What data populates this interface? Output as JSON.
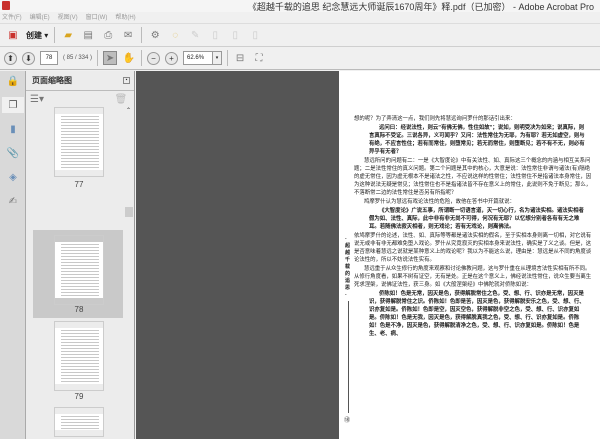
{
  "window": {
    "title": "《超越千载的追思 纪念慧远大师诞辰1670周年》释.pdf（已加密） - Adobe Acrobat Pro"
  },
  "menu": [
    "文件(F)",
    "编辑(E)",
    "视图(V)",
    "窗口(W)",
    "帮助(H)"
  ],
  "toolbar": {
    "create_label": "创建 ▾"
  },
  "nav": {
    "page_value": "78",
    "page_count": "( 85 / 334 )",
    "zoom_value": "62.6%"
  },
  "panel": {
    "title": "页面缩略图",
    "thumbnails": [
      "77",
      "78",
      "79"
    ]
  },
  "page": {
    "side_title": "·超越千载的追思·",
    "page_number": "⑱",
    "paragraphs": [
      "想的呢？为了弄清这一点，我们则先将慧远询问罗什的那话引出来：",
      "远问曰：经说法性，则云\"有佛无佛，性住如故\"；说如，则明受决为如来；说真际，则言真际不受证。三说各异，义可闻乎？又问：法性常住为无耶，为有耶？若无如虚空，则与有绝，不应言性住；若有而常住，则堕常见；若无而常住，则堕断见；若不有不无，则必有异乎有无者？",
      "慧远所问的问题有二：一是《大智度论》中有关法性、如、真际这三个概念的内涵与相互关系问题；二是法性常住的真义问题。第二个问题是其中的核心，大意是说：法性常住非谓与诸法(有)隔绝的虚无常住，因为虚无根本不是诸法之性，不应说这样的性常住；法性常住不是指诸法本身常住，因为这种说法无疑是常见；法性常住也不是指诸法皆不存在意义上的常住，此说则不免于断见；那么，不落断常二边的法性常住是否另有所指呢？",
      "鸠摩罗什认为慧远有戏论法性的危险，故他在答书中开篇就说：",
      "《大智度论》广说五事，所谓断一切语言道，灭一切心行，名为诸法实相。诸法实相者假为如、法性、真际，此中非有非无尚不可得，何况有无耶？以忆想分别者各有有无之难耳。若随佛法寂灭相者，则无戏论；若有无戏论，则离佛法。",
      "依鸠摩罗什的论述，法性、如、真际等等都是诸法实相的假名，至于实相本身则离一切相，对它说有说无或非有非无都难免堕入戏论。罗什从究竟寂灭的实相本身来说法性，确实是了义之谈。但是，这是否意味着慧远之说就是某种意义上的戏论呢？我以为不能这么说，理由是：慧远是从不同的角度谈论法性的，所以不妨说法性实有。",
      "慧远重于从众生修行的角度来观察和讨论佛教问题，这与罗什重在从理境言法性实相有所不同。从修行角度看，如果不树有证空，无有是处。正是在这个意义上，佛经说法性常住，说众生要当离生死求涅槃，说佛证法性，获三身。如《大般涅槃经》中佛陀就对侨陈如说：",
      "侨陈如！色是无常，因灭是色，获得解脱常住之色，受、想、行、识亦是无常，因灭是识，获得解脱常住之识。侨陈如！色即是苦，因灭是色，获得解脱安乐之色，受、想、行、识亦复如是。侨陈如！色即是空，因灭空色，获得解脱非空之色，受、想、行、识亦复如是。侨陈如！色是无我，因灭是色，获得解脱真我之色，受、想、行、识亦复如是。侨陈如！色是不净，因灭是色，获得解脱清净之色，受、想、行、识亦复如是。侨陈如！色是生、老、病、"
    ]
  }
}
